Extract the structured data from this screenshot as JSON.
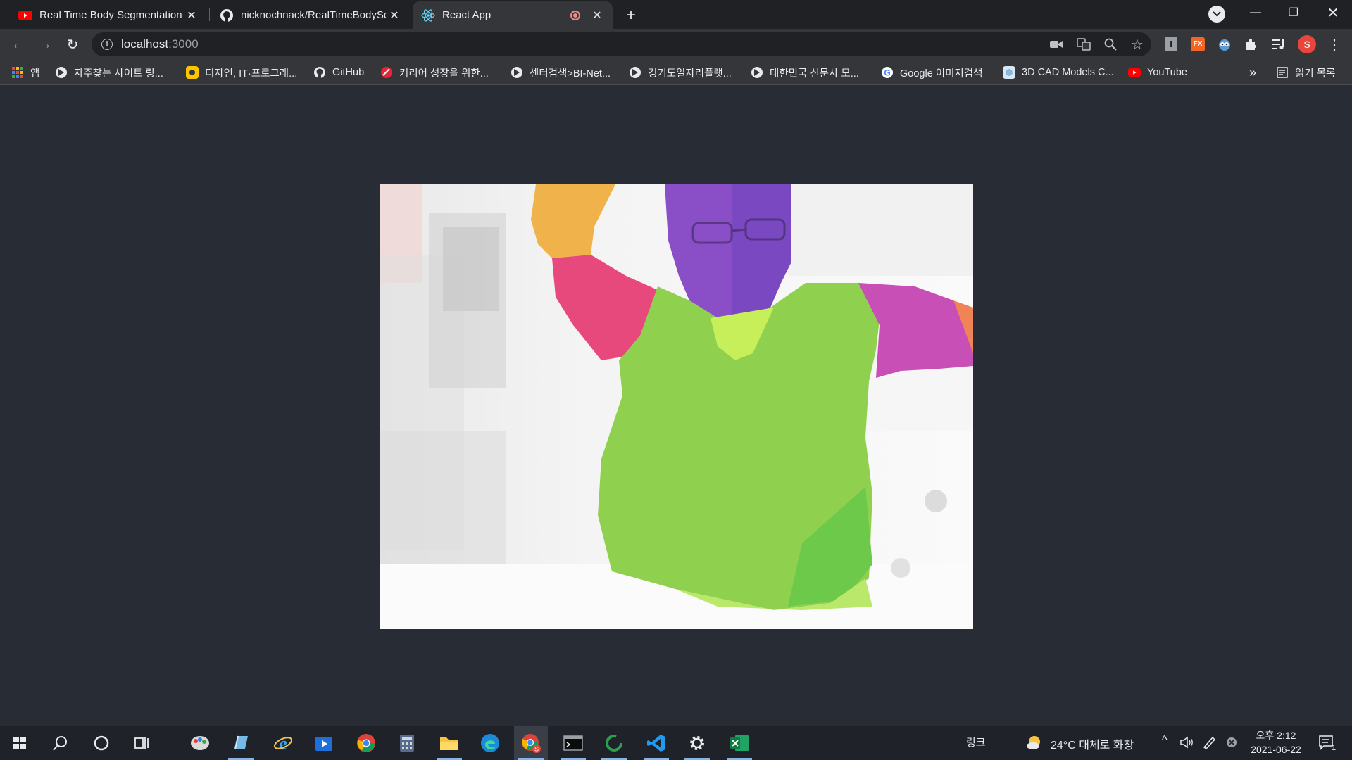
{
  "tabs": [
    {
      "title": "Real Time Body Segmentation T",
      "favicon": "youtube-icon"
    },
    {
      "title": "nicknochnack/RealTimeBodySeg",
      "favicon": "github-icon"
    },
    {
      "title": "React App",
      "favicon": "react-icon",
      "recording": true
    }
  ],
  "omnibox": {
    "host": "localhost",
    "port": ":3000"
  },
  "bookmarks": {
    "items": [
      {
        "label": "앱",
        "icon": "apps-grid-icon"
      },
      {
        "label": "자주찾는 사이트 링...",
        "icon": "globe-icon"
      },
      {
        "label": "디자인, IT·프로그래...",
        "icon": "site-icon"
      },
      {
        "label": "GitHub",
        "icon": "github-icon"
      },
      {
        "label": "커리어 성장을 위한...",
        "icon": "site-icon"
      },
      {
        "label": "센터검색>BI-Net...",
        "icon": "globe-icon"
      },
      {
        "label": "경기도일자리플랫...",
        "icon": "globe-icon"
      },
      {
        "label": "대한민국 신문사 모...",
        "icon": "globe-icon"
      },
      {
        "label": "Google 이미지검색",
        "icon": "google-icon"
      },
      {
        "label": "3D CAD Models C...",
        "icon": "cad-icon"
      },
      {
        "label": "YouTube",
        "icon": "youtube-icon"
      }
    ],
    "overflow": "»",
    "reading_list": "읽기 목록"
  },
  "canvas": {
    "description_label": "body-segmentation-canvas"
  },
  "taskbar": {
    "link_label": "링크",
    "weather": "24°C 대체로 화창",
    "time": "오후 2:12",
    "date": "2021-06-22",
    "notification_count": "1"
  },
  "colors": {
    "page_bg": "#282c34",
    "tabstrip": "#202124",
    "toolbar": "#35363a",
    "taskbar": "#1f2229"
  }
}
